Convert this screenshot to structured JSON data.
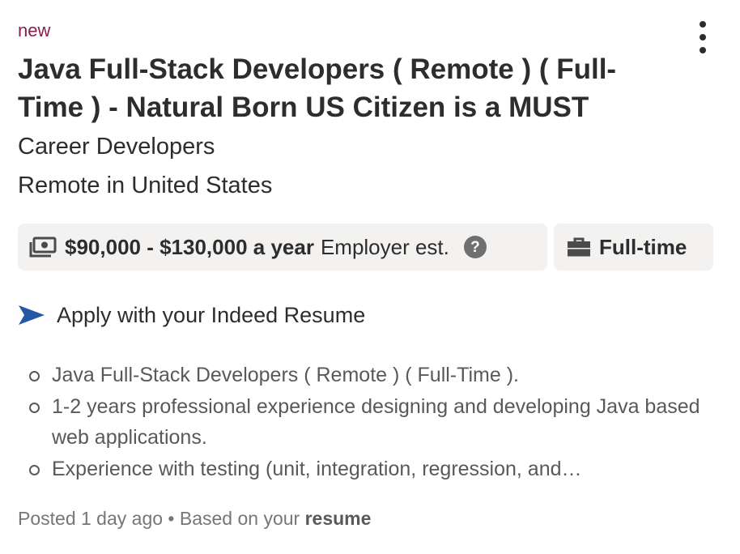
{
  "job": {
    "status_tag": "new",
    "title": "Java Full-Stack Developers ( Remote ) ( Full-Time ) - Natural Born US Citizen is a MUST",
    "company": "Career Developers",
    "location": "Remote in United States",
    "salary": {
      "icon": "money-icon",
      "range": "$90,000 - $130,000 a year",
      "estimate_label": "Employer est.",
      "help_icon": "question-circle-icon",
      "help_glyph": "?"
    },
    "job_type": {
      "icon": "briefcase-icon",
      "label": "Full-time"
    },
    "apply": {
      "icon": "paper-plane-icon",
      "label": "Apply with your Indeed Resume",
      "icon_color": "#2557a7"
    },
    "snippet": [
      "Java Full-Stack Developers ( Remote ) ( Full-Time ).",
      "1-2 years professional experience designing and developing Java based web applications.",
      "Experience with testing (unit, integration, regression, and…"
    ],
    "footer": {
      "posted": "Posted 1 day ago",
      "separator": "•",
      "based_on": "Based on your",
      "based_on_bold": "resume"
    },
    "menu_icon": "more-vertical-icon"
  },
  "colors": {
    "new_tag": "#8c1b4f",
    "chip_bg": "#f3f2f1",
    "text_primary": "#2d2d2d",
    "text_secondary": "#595959",
    "apply_accent": "#2557a7"
  }
}
